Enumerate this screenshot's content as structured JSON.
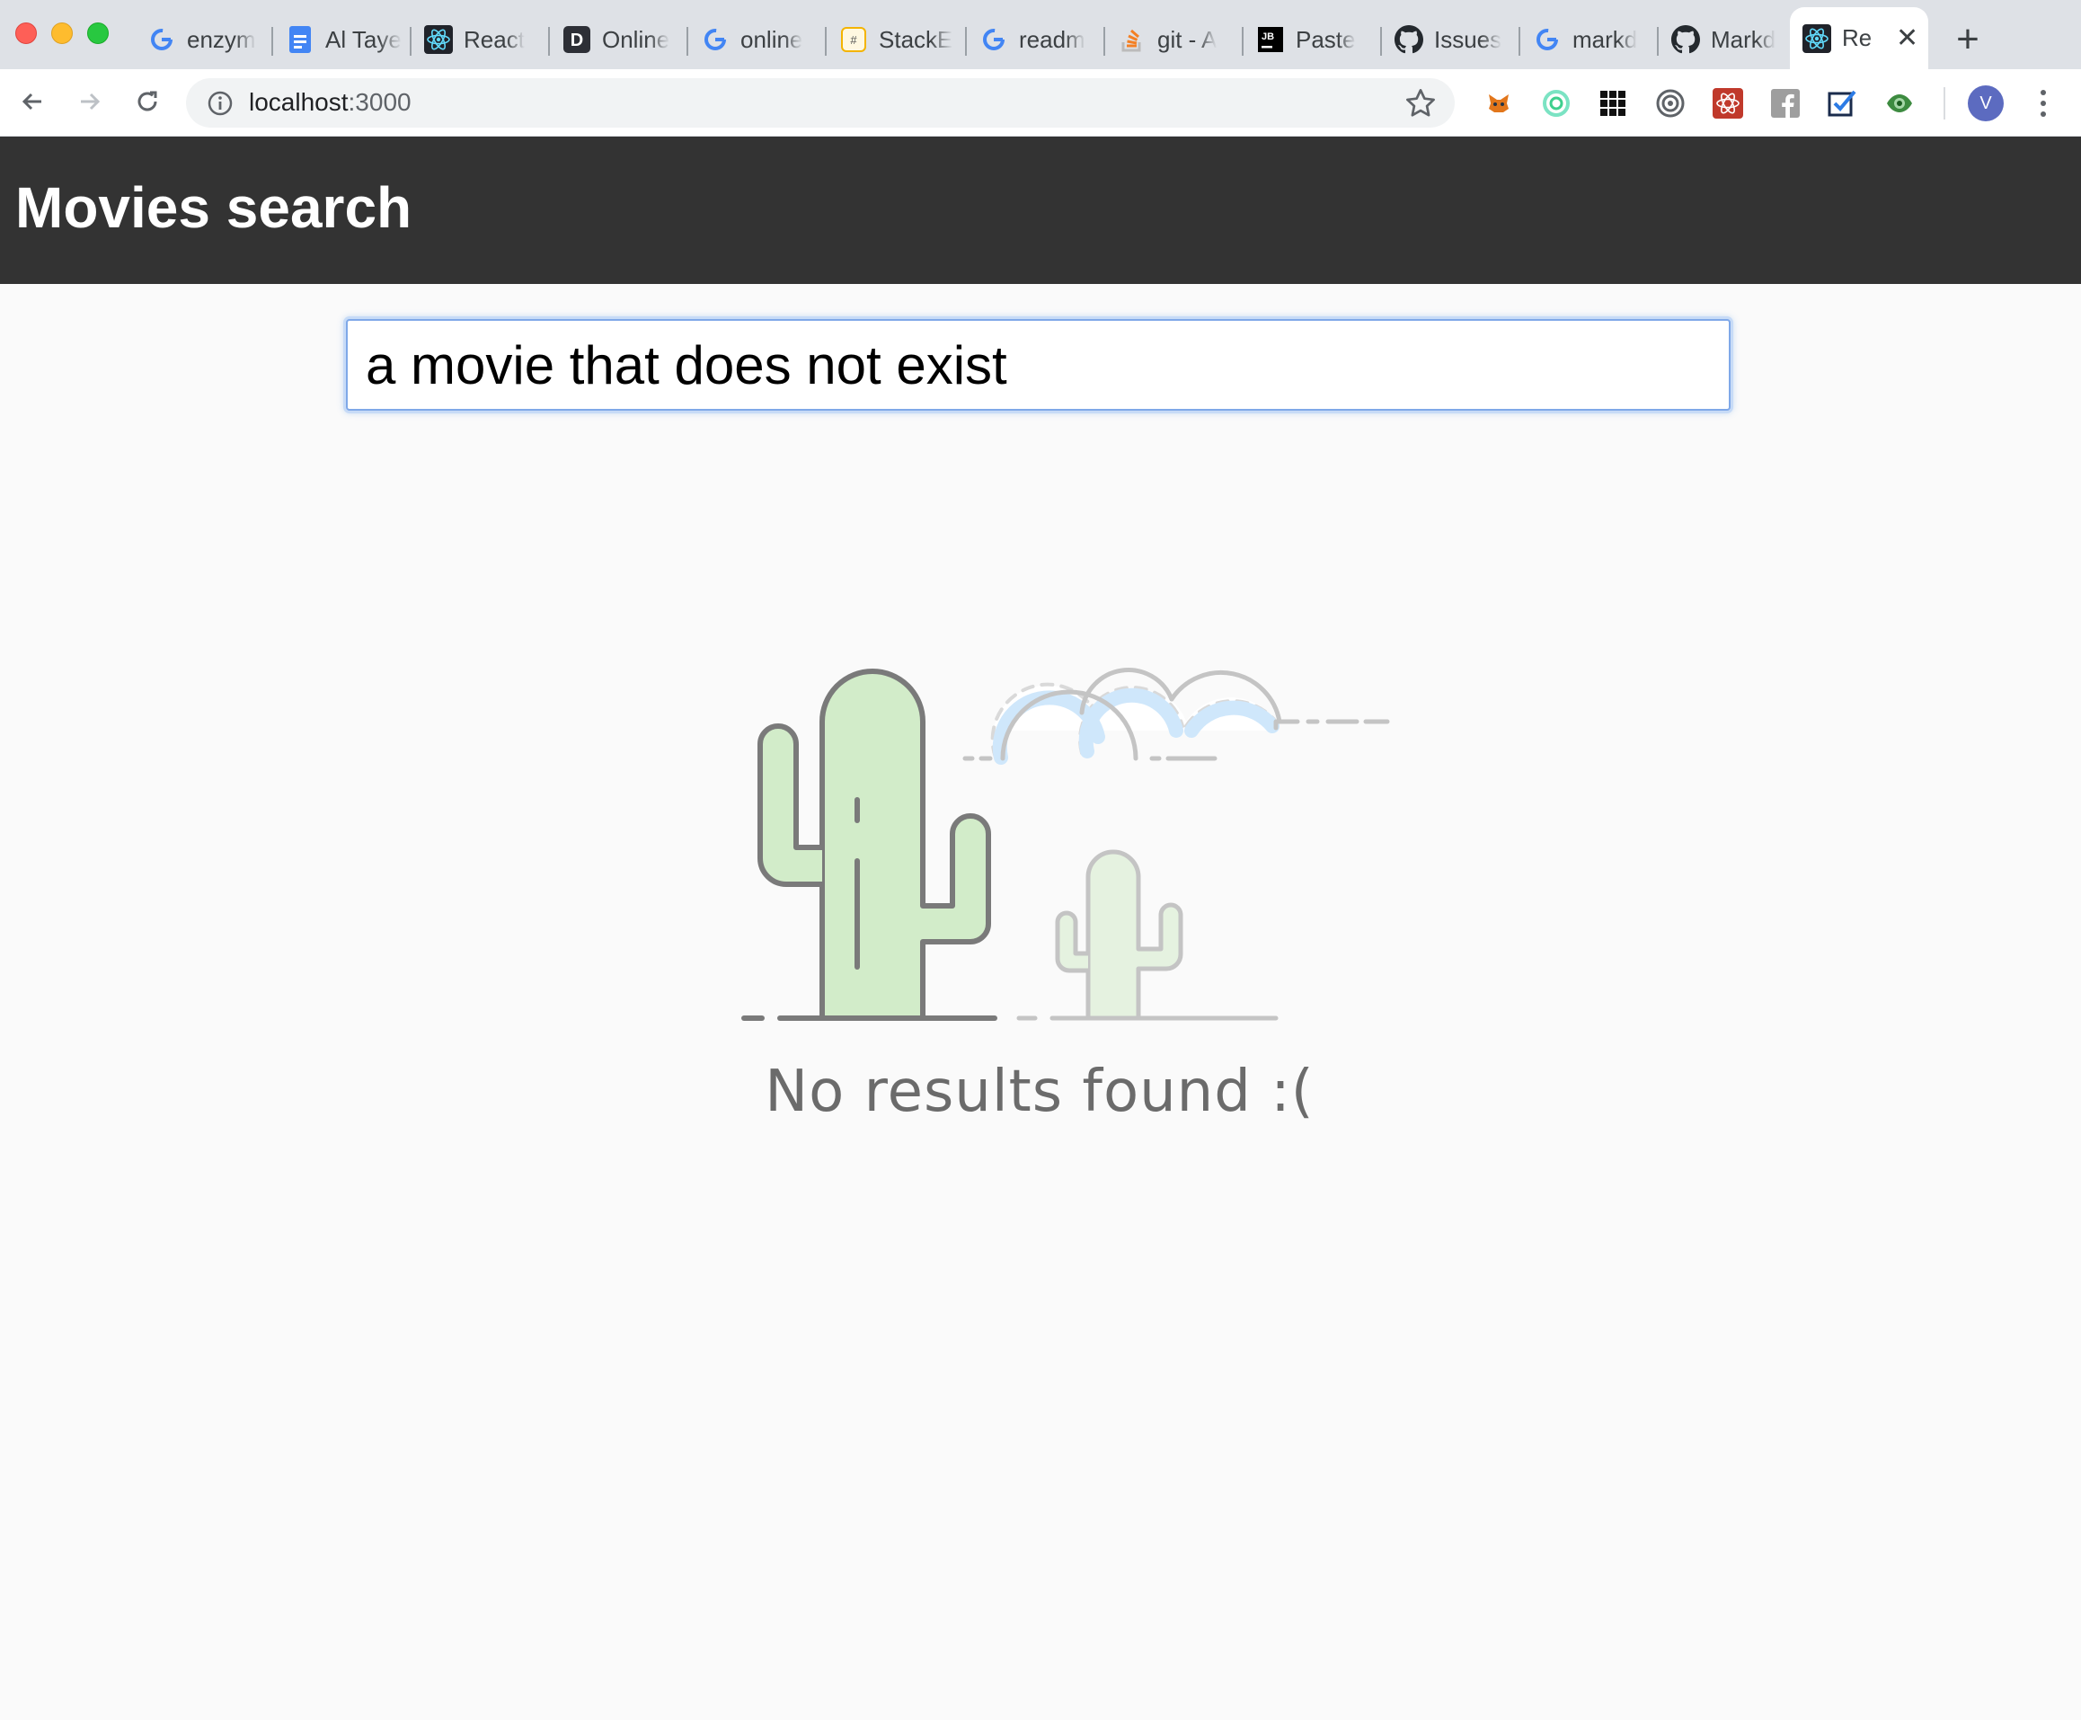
{
  "browser": {
    "tabs": [
      {
        "title": "enzym",
        "icon": "google-icon"
      },
      {
        "title": "Al Taye",
        "icon": "google-docs-icon"
      },
      {
        "title": "React",
        "icon": "react-icon"
      },
      {
        "title": "Online",
        "icon": "d-logo-icon"
      },
      {
        "title": "online",
        "icon": "google-icon"
      },
      {
        "title": "StackE",
        "icon": "stackedit-icon"
      },
      {
        "title": "readm",
        "icon": "google-icon"
      },
      {
        "title": "git - A",
        "icon": "stackoverflow-icon"
      },
      {
        "title": "Paste",
        "icon": "jetbrains-icon"
      },
      {
        "title": "Issues",
        "icon": "github-icon"
      },
      {
        "title": "markd",
        "icon": "google-icon"
      },
      {
        "title": "Markd",
        "icon": "github-icon"
      }
    ],
    "active_tab": {
      "title": "Re",
      "icon": "react-icon"
    },
    "url_host": "localhost",
    "url_port": ":3000",
    "profile_initial": "V",
    "extensions": [
      "metamask-icon",
      "circle-extension-icon",
      "grid-extension-icon",
      "target-extension-icon",
      "react-devtools-icon",
      "facebook-icon",
      "checkbox-extension-icon",
      "eye-extension-icon"
    ]
  },
  "app": {
    "title": "Movies search",
    "search_value": "a movie that does not exist",
    "empty_message": "No results found :("
  }
}
